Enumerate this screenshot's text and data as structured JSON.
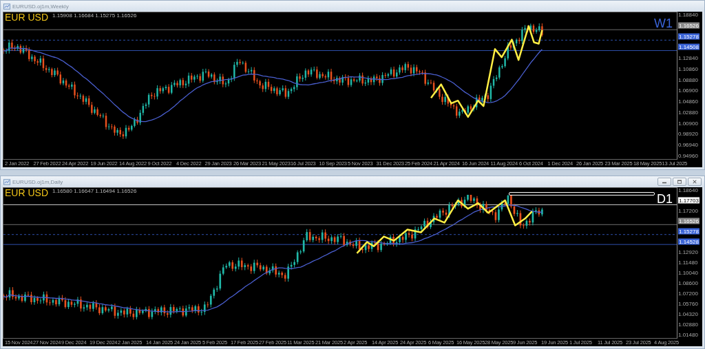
{
  "windows": [
    {
      "title": "EURUSD.oj1m,Weekly",
      "kind": "weekly",
      "window_buttons": false,
      "symbol": "EUR USD",
      "ohlc": "1.15908 1.16684 1.15275 1.16526",
      "timeframe": "W1",
      "color": "#3a64d8",
      "rectangle_object": false,
      "price_axis": [
        {
          "kind": "tick",
          "text": "1.18840"
        },
        {
          "kind": "marker",
          "text": "1.16526",
          "color": "#8a8a8a",
          "dashed": false
        },
        {
          "kind": "marker",
          "text": "1.15278",
          "color": "#3a64d8",
          "dashed": true
        },
        {
          "kind": "marker",
          "text": "1.14508",
          "color": "#3a64d8",
          "dashed": false
        },
        {
          "kind": "tick",
          "text": "1.12840"
        },
        {
          "kind": "tick",
          "text": "1.10860"
        },
        {
          "kind": "tick",
          "text": "1.08880"
        },
        {
          "kind": "tick",
          "text": "1.06900"
        },
        {
          "kind": "tick",
          "text": "1.04860"
        },
        {
          "kind": "tick",
          "text": "1.02880"
        },
        {
          "kind": "tick",
          "text": "1.00900"
        },
        {
          "kind": "tick",
          "text": "0.98920"
        },
        {
          "kind": "tick",
          "text": "0.96940"
        },
        {
          "kind": "tick",
          "text": "0.94960"
        }
      ],
      "date_axis": [
        "2 Jan 2022",
        "27 Feb 2022",
        "24 Apr 2022",
        "19 Jun 2022",
        "14 Aug 2022",
        "9 Oct 2022",
        "4 Dec 2022",
        "29 Jan 2023",
        "26 Mar 2023",
        "21 May 2023",
        "16 Jul 2023",
        "10 Sep 2023",
        "5 Nov 2023",
        "31 Dec 2023",
        "25 Feb 2024",
        "21 Apr 2024",
        "16 Jun 2024",
        "11 Aug 2024",
        "6 Oct 2024",
        "1 Dec 2024",
        "26 Jan 2025",
        "23 Mar 2025",
        "18 May 2025",
        "13 Jul 2025"
      ]
    },
    {
      "title": "EURUSD.oj1m,Daily",
      "kind": "daily",
      "window_buttons": true,
      "symbol": "EUR USD",
      "ohlc": "1.16580 1.16647 1.16494 1.16526",
      "timeframe": "D1",
      "color": "#ffffff",
      "rectangle_object": true,
      "price_axis": [
        {
          "kind": "tick",
          "text": "1.18640"
        },
        {
          "kind": "marker",
          "text": "1.17703",
          "color": "#ffffff",
          "dashed": false
        },
        {
          "kind": "tick",
          "text": "1.17200"
        },
        {
          "kind": "marker",
          "text": "1.16526",
          "color": "#8a8a8a",
          "dashed": false
        },
        {
          "kind": "marker",
          "text": "1.15278",
          "color": "#3a64d8",
          "dashed": true
        },
        {
          "kind": "marker",
          "text": "1.14528",
          "color": "#3a64d8",
          "dashed": false
        },
        {
          "kind": "tick",
          "text": "1.12920"
        },
        {
          "kind": "tick",
          "text": "1.11480"
        },
        {
          "kind": "tick",
          "text": "1.10040"
        },
        {
          "kind": "tick",
          "text": "1.08600"
        },
        {
          "kind": "tick",
          "text": "1.07200"
        },
        {
          "kind": "tick",
          "text": "1.05760"
        },
        {
          "kind": "tick",
          "text": "1.04320"
        },
        {
          "kind": "tick",
          "text": "1.02880"
        },
        {
          "kind": "tick",
          "text": "1.01480"
        }
      ],
      "date_axis": [
        "15 Nov 2024",
        "27 Nov 2024",
        "9 Dec 2024",
        "19 Dec 2024",
        "2 Jan 2025",
        "14 Jan 2025",
        "24 Jan 2025",
        "5 Feb 2025",
        "17 Feb 2025",
        "27 Feb 2025",
        "11 Mar 2025",
        "21 Mar 2025",
        "2 Apr 2025",
        "14 Apr 2025",
        "24 Apr 2025",
        "6 May 2025",
        "16 May 2025",
        "28 May 2025",
        "9 Jun 2025",
        "19 Jun 2025",
        "1 Jul 2025",
        "11 Jul 2025",
        "23 Jul 2025",
        "4 Aug 2025"
      ]
    }
  ]
}
